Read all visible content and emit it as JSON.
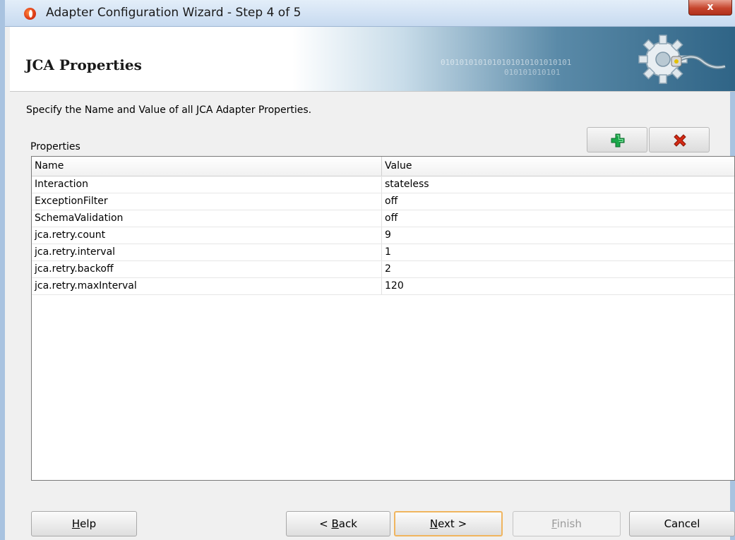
{
  "window": {
    "title": "Adapter Configuration Wizard - Step 4 of 5",
    "close_label": "x"
  },
  "header": {
    "title": "JCA Properties",
    "binary_decor_1": "0101010101010101010101010101",
    "binary_decor_2": "010101010101"
  },
  "instruction": "Specify the Name and Value of all JCA Adapter Properties.",
  "properties": {
    "label": "Properties",
    "add_icon": "plus-icon",
    "remove_icon": "x-icon",
    "columns": [
      "Name",
      "Value"
    ],
    "rows": [
      {
        "name": "Interaction",
        "value": "stateless"
      },
      {
        "name": "ExceptionFilter",
        "value": "off"
      },
      {
        "name": "SchemaValidation",
        "value": "off"
      },
      {
        "name": "jca.retry.count",
        "value": "9"
      },
      {
        "name": "jca.retry.interval",
        "value": "1"
      },
      {
        "name": "jca.retry.backoff",
        "value": "2"
      },
      {
        "name": "jca.retry.maxInterval",
        "value": "120"
      }
    ]
  },
  "buttons": {
    "help": {
      "label": "Help",
      "mnemonic": "H",
      "rest": "elp"
    },
    "back": {
      "label": "< Back",
      "prefix": "< ",
      "mnemonic": "B",
      "rest": "ack"
    },
    "next": {
      "label": "Next >",
      "mnemonic": "N",
      "rest": "ext >"
    },
    "finish": {
      "label": "Finish",
      "mnemonic": "F",
      "rest": "inish",
      "enabled": false
    },
    "cancel": {
      "label": "Cancel"
    }
  },
  "colors": {
    "add_icon": "#1aa84a",
    "remove_icon": "#d42a14",
    "next_focus_border": "#f0b55f"
  }
}
